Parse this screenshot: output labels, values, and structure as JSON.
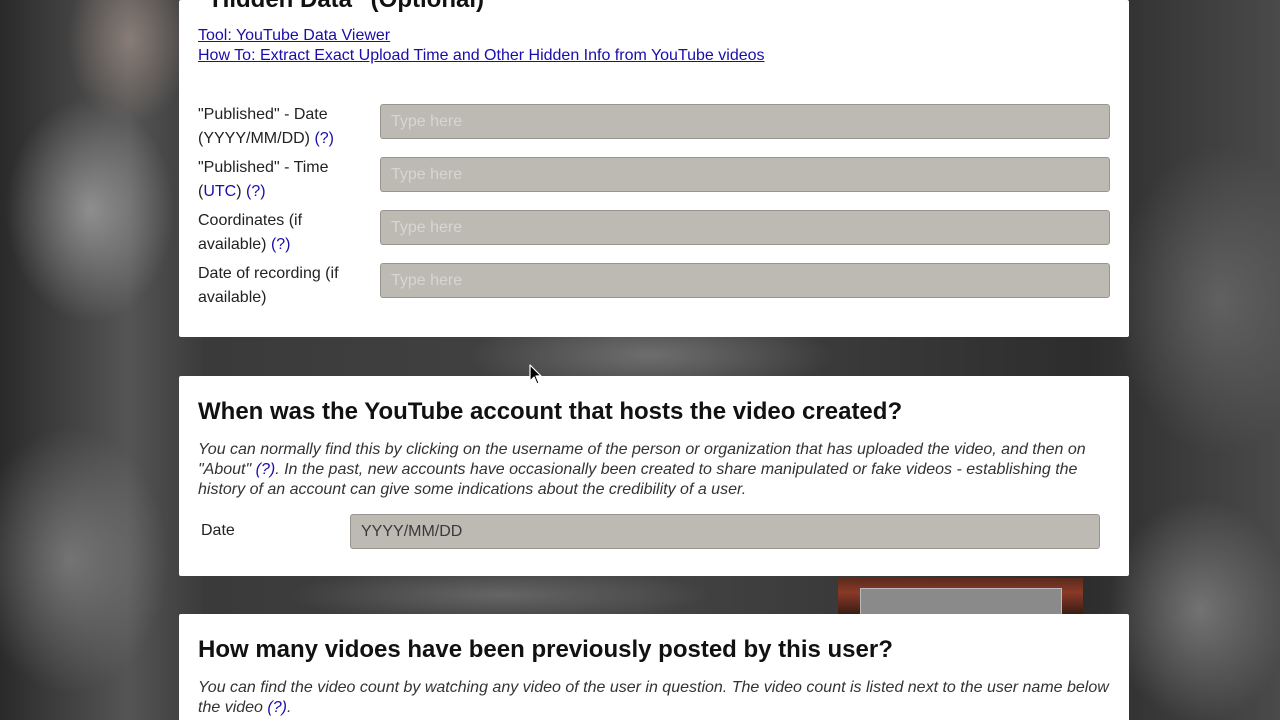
{
  "hidden_data": {
    "heading": "Hidden Data” (Optional)",
    "tool_link": "Tool: YouTube Data Viewer",
    "howto_link": "How To: Extract Exact Upload Time and Other Hidden Info from YouTube videos",
    "fields": [
      {
        "label": "\"Published\" - Date (YYYY/MM/DD)",
        "help": "(?)",
        "placeholder": "Type here"
      },
      {
        "label_pre": "\"Published\" - Time (",
        "label_link": "UTC",
        "label_post": ")",
        "help": "(?)",
        "placeholder": "Type here"
      },
      {
        "label": "Coordinates (if available)",
        "help": "(?)",
        "placeholder": "Type here"
      },
      {
        "label": "Date of recording (if available)",
        "placeholder": "Type here"
      }
    ]
  },
  "account": {
    "heading": "When was the YouTube account that hosts the video created?",
    "desc_pre": "You can normally find this by clicking on the username of the person or organization that has uploaded the video, and then on \"About\" ",
    "desc_help": "(?)",
    "desc_post": ". In the past, new accounts have occasionally been created to share manipulated or fake videos - establishing the history of an account can give some indications about the credibility of a user.",
    "date_label": "Date",
    "date_placeholder": "YYYY/MM/DD"
  },
  "videos": {
    "heading": "How many vidoes have been previously posted by this user?",
    "desc_pre": "You can find the video count by watching any video of the user in question. The video count is listed next to the user name below the video ",
    "desc_help": "(?)",
    "desc_post": "."
  },
  "colors": {
    "link": "#1a0dab",
    "input_bg": "#bdb9b3",
    "panel_bg": "#ffffff"
  },
  "icons": {
    "cursor": "mouse-pointer-icon"
  }
}
